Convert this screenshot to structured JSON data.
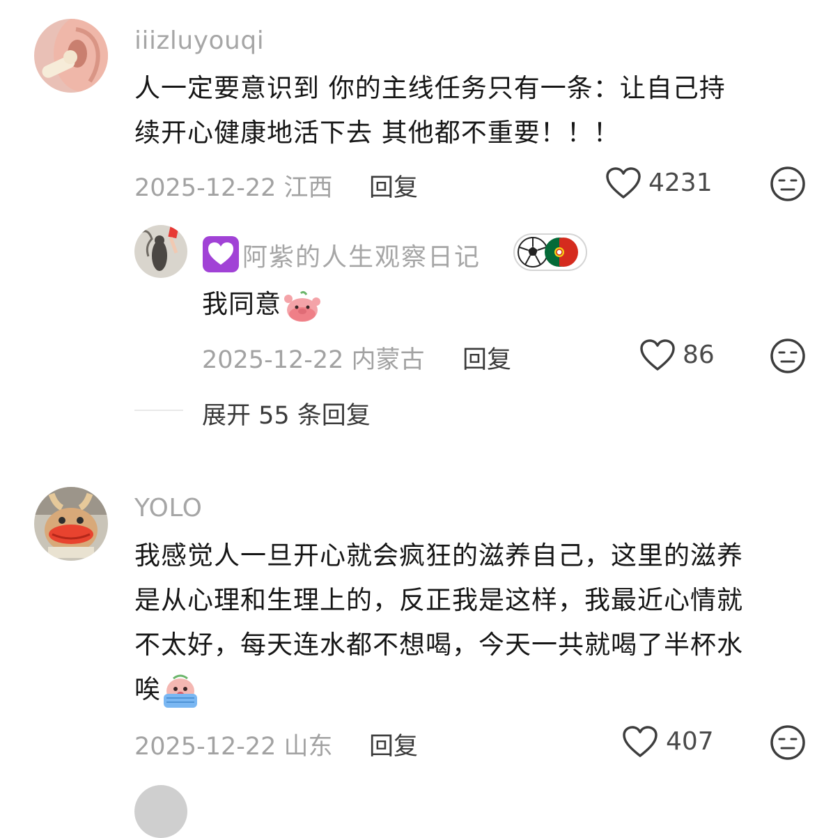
{
  "comments": [
    {
      "username": "iiizluyouqi",
      "text_line1": "人一定要意识到 你的主线任务只有一条：让自己持",
      "text_line2": "续开心健康地活下去 其他都不重要！！！",
      "date": "2025-12-22",
      "location": "江西",
      "reply_label": "回复",
      "likes": "4231",
      "reply": {
        "username": "阿紫的人生观察日记",
        "text": "我同意",
        "date": "2025-12-22",
        "location": "内蒙古",
        "reply_label": "回复",
        "likes": "86"
      },
      "expand_label": "展开 55 条回复"
    },
    {
      "username": "YOLO",
      "text_line1": "我感觉人一旦开心就会疯狂的滋养自己，这里的滋养",
      "text_line2": "是从心理和生理上的，反正我是这样，我最近心情就",
      "text_line3": "不太好，每天连水都不想喝，今天一共就喝了半杯水",
      "text_line4": "唉",
      "date": "2025-12-22",
      "location": "山东",
      "reply_label": "回复",
      "likes": "407"
    }
  ],
  "icons": {
    "like": "heart-outline-icon",
    "dislike": "neutral-face-icon",
    "badge_heart": "purple-heart-icon",
    "badge_flag": "soccer-portugal-badge-icon",
    "emoji_pig": "pig-waving-emoji",
    "emoji_crying": "crying-pig-emoji"
  },
  "colors": {
    "username": "#a6a6a6",
    "text": "#161616",
    "meta": "#a2a2a2",
    "purple": "#a142d6"
  }
}
